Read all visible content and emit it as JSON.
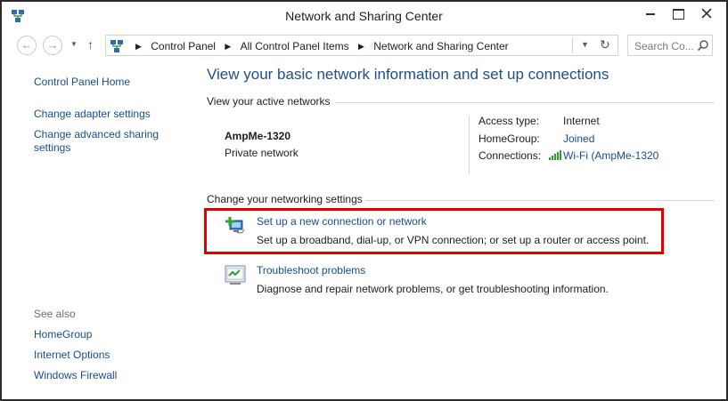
{
  "window": {
    "title": "Network and Sharing Center"
  },
  "nav": {
    "back_icon": "back-arrow-icon",
    "forward_icon": "forward-arrow-icon",
    "up_icon": "up-arrow-icon",
    "breadcrumbs": [
      "Control Panel",
      "All Control Panel Items",
      "Network and Sharing Center"
    ],
    "search_placeholder": "Search Co..."
  },
  "sidebar": {
    "home": "Control Panel Home",
    "links": [
      "Change adapter settings",
      "Change advanced sharing settings"
    ],
    "see_also_heading": "See also",
    "see_also": [
      "HomeGroup",
      "Internet Options",
      "Windows Firewall"
    ]
  },
  "main": {
    "title": "View your basic network information and set up connections",
    "active_networks_heading": "View your active networks",
    "network": {
      "name": "AmpMe-1320",
      "type": "Private network",
      "access_type_label": "Access type:",
      "access_type_value": "Internet",
      "homegroup_label": "HomeGroup:",
      "homegroup_value": "Joined",
      "connections_label": "Connections:",
      "connections_value": "Wi-Fi (AmpMe-1320"
    },
    "change_settings_heading": "Change your networking settings",
    "tasks": [
      {
        "title": "Set up a new connection or network",
        "description": "Set up a broadband, dial-up, or VPN connection; or set up a router or access point."
      },
      {
        "title": "Troubleshoot problems",
        "description": "Diagnose and repair network problems, or get troubleshooting information."
      }
    ]
  },
  "colors": {
    "link": "#1a4d8f",
    "title": "#1e4e8c",
    "highlight": "#e00000"
  }
}
